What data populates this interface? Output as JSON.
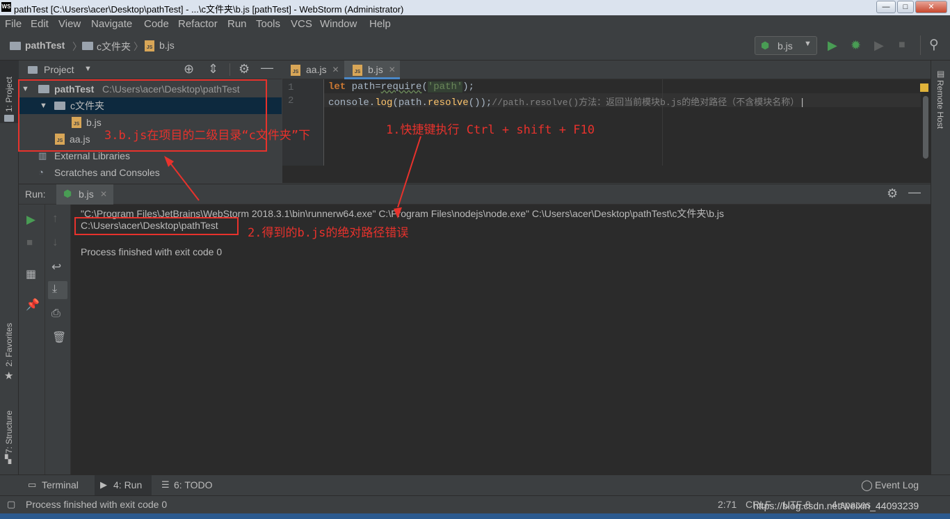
{
  "window": {
    "title": "pathTest [C:\\Users\\acer\\Desktop\\pathTest] - ...\\c文件夹\\b.js [pathTest] - WebStorm (Administrator)",
    "logo": "WS",
    "minimize": "—",
    "maximize": "□",
    "close": "✕"
  },
  "menu": [
    "File",
    "Edit",
    "View",
    "Navigate",
    "Code",
    "Refactor",
    "Run",
    "Tools",
    "VCS",
    "Window",
    "Help"
  ],
  "breadcrumb": {
    "project": "pathTest",
    "folder": "c文件夹",
    "file": "b.js"
  },
  "run_config": {
    "label": "b.js"
  },
  "left_tools": {
    "project": "1: Project",
    "favorites": "2: Favorites",
    "structure": "7: Structure"
  },
  "project_panel": {
    "title": "Project",
    "tree": {
      "root_name": "pathTest",
      "root_path": "C:\\Users\\acer\\Desktop\\pathTest",
      "folder": "c文件夹",
      "file_b": "b.js",
      "file_aa": "aa.js",
      "external": "External Libraries",
      "scratches": "Scratches and Consoles"
    }
  },
  "editor": {
    "tabs": [
      "aa.js",
      "b.js"
    ],
    "line_numbers": [
      "1",
      "2"
    ],
    "line1": {
      "kw": "let",
      "a": " path=",
      "fn": "require",
      "b": "(",
      "str": "'path'",
      "c": ");"
    },
    "line2": {
      "a": "console.",
      "fn": "log",
      "b": "(path.",
      "fn2": "resolve",
      "c": "());",
      "comment": "//path.resolve()方法：返回当前模块b.js的绝对路径（不含模块名称）"
    }
  },
  "right_tools": {
    "remote_host": "Remote Host"
  },
  "run_panel": {
    "label": "Run:",
    "tab": "b.js",
    "console": {
      "cmd": "\"C:\\Program Files\\JetBrains\\WebStorm 2018.3.1\\bin\\runnerw64.exe\" C:\\Program Files\\nodejs\\node.exe\" C:\\Users\\acer\\Desktop\\pathTest\\c文件夹\\b.js",
      "output": "C:\\Users\\acer\\Desktop\\pathTest",
      "finish": "Process finished with exit code 0"
    }
  },
  "annotations": {
    "a1": "1.快捷键执行 Ctrl + shift + F10",
    "a2": "2.得到的b.js的绝对路径错误",
    "a3": "3.b.js在项目的二级目录“c文件夹”下"
  },
  "bottom_tools": {
    "terminal": "Terminal",
    "run": "4: Run",
    "todo": "6: TODO",
    "event_log": "Event Log"
  },
  "status": {
    "message": "Process finished with exit code 0",
    "position": "2:71",
    "line_sep": "CRLF",
    "encoding": "UTF-8",
    "indent": "4 spaces",
    "watermark": "https://blog.csdn.net/weixin_44093239"
  },
  "colors": {
    "accent_red": "#e8322c",
    "keyword": "#cc7832",
    "string": "#6a8759",
    "function": "#ffc66d",
    "comment": "#808080",
    "run_green": "#499c54"
  }
}
